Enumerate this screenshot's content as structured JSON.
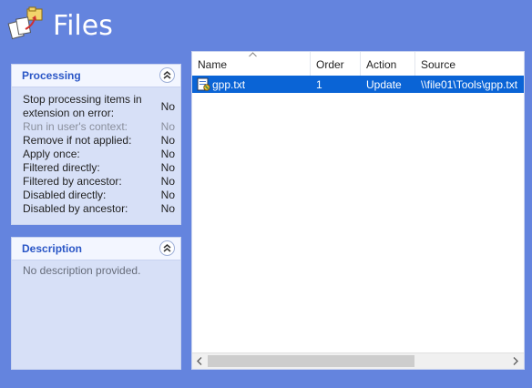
{
  "header": {
    "title": "Files",
    "icon": "files-folder-icon"
  },
  "processing": {
    "title": "Processing",
    "rows": [
      {
        "label_line1": "Stop processing items in",
        "label_line2": "extension on error:",
        "value": "No",
        "disabled": false
      },
      {
        "label": "Run in user's context:",
        "value": "No",
        "disabled": true
      },
      {
        "label": "Remove if not applied:",
        "value": "No",
        "disabled": false
      },
      {
        "label": "Apply once:",
        "value": "No",
        "disabled": false
      },
      {
        "label": "Filtered directly:",
        "value": "No",
        "disabled": false
      },
      {
        "label": "Filtered by ancestor:",
        "value": "No",
        "disabled": false
      },
      {
        "label": "Disabled directly:",
        "value": "No",
        "disabled": false
      },
      {
        "label": "Disabled by ancestor:",
        "value": "No",
        "disabled": false
      }
    ]
  },
  "description": {
    "title": "Description",
    "text": "No description provided."
  },
  "list": {
    "columns": [
      "Name",
      "Order",
      "Action",
      "Source"
    ],
    "sort_column": "Name",
    "rows": [
      {
        "name": "gpp.txt",
        "order": "1",
        "action": "Update",
        "source": "\\\\file01\\Tools\\gpp.txt",
        "selected": true
      }
    ]
  },
  "colors": {
    "background": "#6484de",
    "selection": "#0a64d6",
    "panel_title": "#2a56c6"
  }
}
